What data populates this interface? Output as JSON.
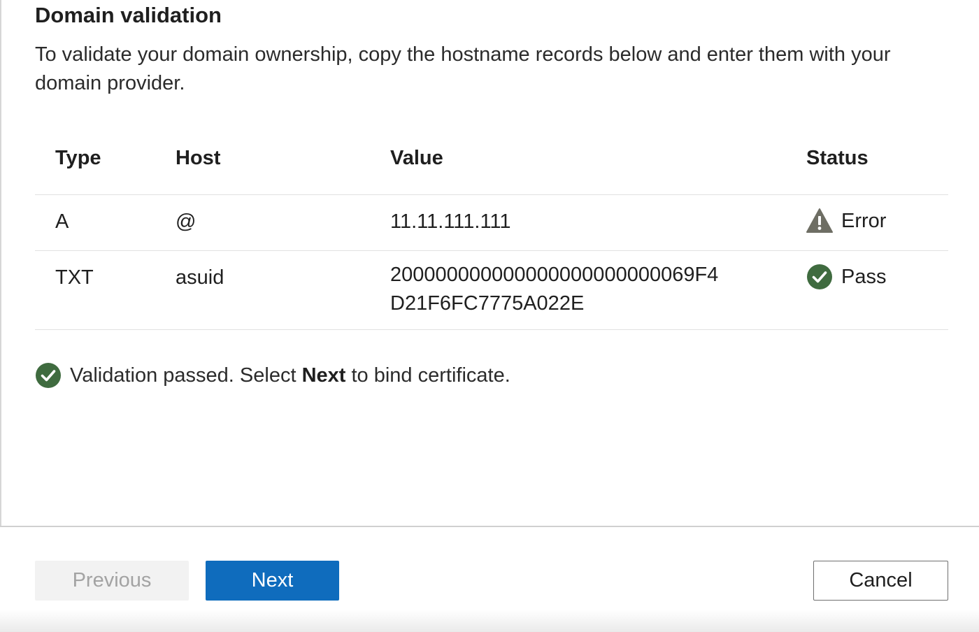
{
  "section": {
    "title": "Domain validation",
    "description": "To validate your domain ownership, copy the hostname records below and enter them with your domain provider."
  },
  "table": {
    "headers": {
      "type": "Type",
      "host": "Host",
      "value": "Value",
      "status": "Status"
    },
    "rows": [
      {
        "type": "A",
        "host": "@",
        "value": "11.11.111.111",
        "status": "Error",
        "status_icon": "warning-icon"
      },
      {
        "type": "TXT",
        "host": "asuid",
        "value": "200000000000000000000000069F4D21F6FC7775A022E",
        "status": "Pass",
        "status_icon": "check-circle-icon"
      }
    ]
  },
  "validation": {
    "icon": "check-circle-icon",
    "prefix": "Validation passed. Select ",
    "emphasis": "Next",
    "suffix": " to bind certificate."
  },
  "footer": {
    "previous_label": "Previous",
    "next_label": "Next",
    "cancel_label": "Cancel"
  },
  "colors": {
    "primary": "#0f6cbd",
    "success": "#3f6b3f",
    "warning": "#6e6e64",
    "disabled_bg": "#f2f2f2",
    "disabled_text": "#a3a3a3"
  }
}
